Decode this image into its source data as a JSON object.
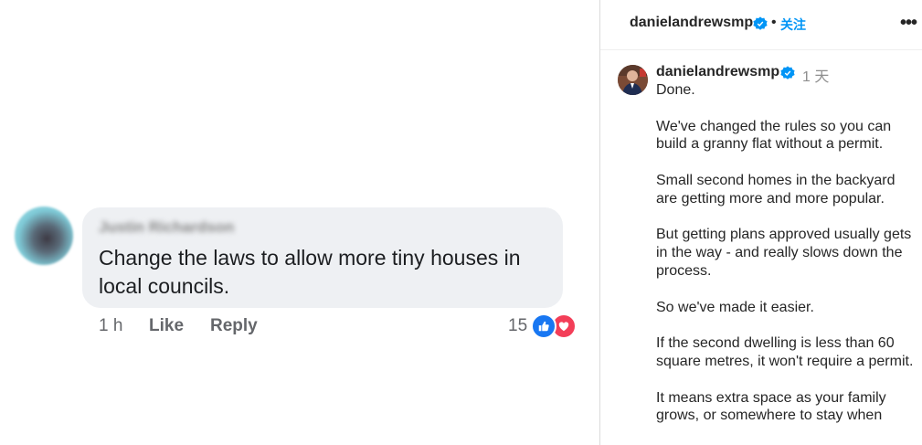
{
  "comment": {
    "author": "Justin Richardson",
    "text": "Change the laws to allow more tiny houses in local councils.",
    "time": "1 h",
    "like_label": "Like",
    "reply_label": "Reply",
    "reaction_count": "15",
    "reaction_icons": [
      "like-icon",
      "love-icon"
    ]
  },
  "post": {
    "header": {
      "username": "danielandrewsmp",
      "separator": "•",
      "follow_label": "关注",
      "more_icon": "more-options-icon"
    },
    "caption": {
      "username": "danielandrewsmp",
      "time": "1 天",
      "paragraphs": [
        "Done.",
        "We've changed the rules so you can build a granny flat without a permit.",
        "Small second homes in the backyard are getting more and more popular.",
        "But getting plans approved usually gets in the way - and really slows down the process.",
        "So we've made it easier.",
        "If the second dwelling is less than 60 square metres, it won't require a permit.",
        "It means extra space as your family grows, or somewhere to stay when"
      ]
    }
  },
  "colors": {
    "facebook_blue": "#1877f2",
    "love_red": "#f33e58",
    "instagram_link": "#0095f6",
    "verified_blue": "#0095f6",
    "bubble_bg": "#eef0f3"
  }
}
